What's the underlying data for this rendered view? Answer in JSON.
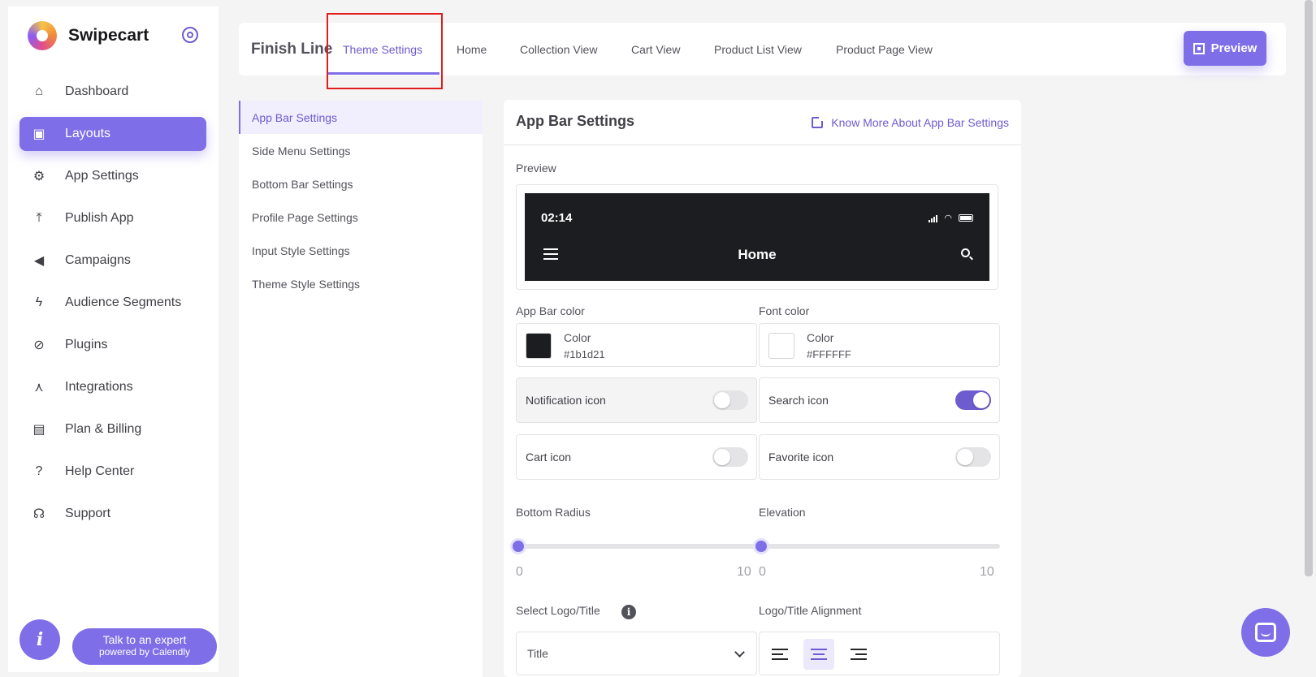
{
  "brand": {
    "name": "Swipecart"
  },
  "sidebar": {
    "items": [
      {
        "label": "Dashboard",
        "icon": "home-icon",
        "active": false
      },
      {
        "label": "Layouts",
        "icon": "layouts-icon",
        "active": true
      },
      {
        "label": "App Settings",
        "icon": "gear-icon",
        "active": false
      },
      {
        "label": "Publish App",
        "icon": "upload-icon",
        "active": false
      },
      {
        "label": "Campaigns",
        "icon": "megaphone-icon",
        "active": false
      },
      {
        "label": "Audience Segments",
        "icon": "lightning-icon",
        "active": false
      },
      {
        "label": "Plugins",
        "icon": "plug-icon",
        "active": false
      },
      {
        "label": "Integrations",
        "icon": "network-icon",
        "active": false
      },
      {
        "label": "Plan & Billing",
        "icon": "invoice-icon",
        "active": false
      },
      {
        "label": "Help Center",
        "icon": "help-icon",
        "active": false
      },
      {
        "label": "Support",
        "icon": "headset-icon",
        "active": false
      }
    ],
    "info_label": "i",
    "expert": {
      "line1": "Talk to an expert",
      "line2": "powered by Calendly"
    }
  },
  "header": {
    "app_name": "Finish Line",
    "tabs": [
      {
        "label": "Theme Settings",
        "active": true
      },
      {
        "label": "Home"
      },
      {
        "label": "Collection View"
      },
      {
        "label": "Cart View"
      },
      {
        "label": "Product List View"
      },
      {
        "label": "Product Page View"
      }
    ],
    "preview_label": "Preview"
  },
  "settings_menu": [
    {
      "label": "App Bar Settings",
      "active": true
    },
    {
      "label": "Side Menu Settings"
    },
    {
      "label": "Bottom Bar Settings"
    },
    {
      "label": "Profile Page Settings"
    },
    {
      "label": "Input Style Settings"
    },
    {
      "label": "Theme Style Settings"
    }
  ],
  "panel": {
    "title": "App Bar Settings",
    "know_more": "Know More About App Bar Settings",
    "preview_label": "Preview",
    "phone": {
      "time": "02:14",
      "title": "Home"
    },
    "app_bar_color": {
      "label": "App Bar color",
      "name": "Color",
      "hex": "#1b1d21"
    },
    "font_color": {
      "label": "Font color",
      "name": "Color",
      "hex": "#FFFFFF"
    },
    "toggles": {
      "notification": {
        "label": "Notification icon",
        "on": false
      },
      "search": {
        "label": "Search icon",
        "on": true
      },
      "cart": {
        "label": "Cart icon",
        "on": false
      },
      "favorite": {
        "label": "Favorite icon",
        "on": false
      }
    },
    "bottom_radius": {
      "label": "Bottom Radius",
      "min": "0",
      "max": "10",
      "value": 0
    },
    "elevation": {
      "label": "Elevation",
      "min": "0",
      "max": "10",
      "value": 0
    },
    "logo_title": {
      "label": "Select Logo/Title",
      "value": "Title",
      "info": "i"
    },
    "alignment": {
      "label": "Logo/Title Alignment",
      "selected": "center"
    }
  },
  "colors": {
    "accent": "#7e6ee8",
    "highlight": "#e11d1d"
  }
}
